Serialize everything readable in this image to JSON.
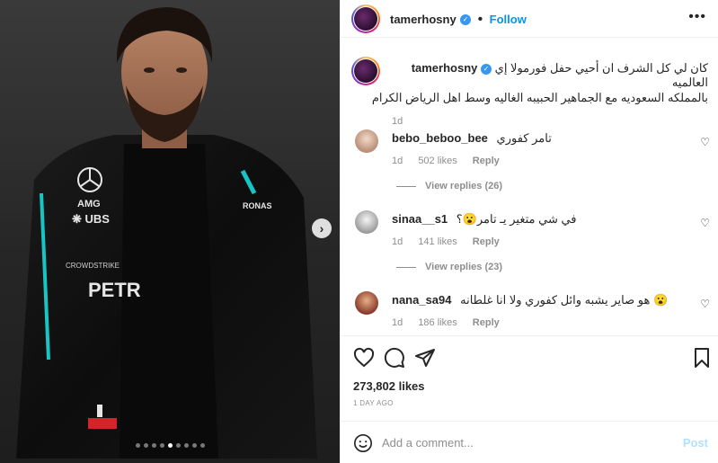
{
  "post": {
    "author": "tamerhosny",
    "follow_label": "Follow",
    "more_label": "•••",
    "caption_line1": "كان لي كل الشرف ان أحيي حفل فورمولا إي العالميه",
    "caption_line2": "بالمملكه السعوديه مع الجماهير الحبيبه الغاليه وسط اهل الرياض الكرام",
    "caption_age": "1d",
    "likes": "273,802 likes",
    "date": "1 DAY AGO",
    "carousel_next": "›",
    "carousel_dots": 9,
    "carousel_active": 5
  },
  "comments": [
    {
      "user": "bebo_beboo_bee",
      "text": "تامر كفوري",
      "age": "1d",
      "likes": "502 likes",
      "reply": "Reply",
      "view_replies": "View replies (26)"
    },
    {
      "user": "sinaa__s1",
      "text": "في شي متغير يـ تامر😮؟",
      "age": "1d",
      "likes": "141 likes",
      "reply": "Reply",
      "view_replies": "View replies (23)"
    },
    {
      "user": "nana_sa94",
      "text": "هو صاير يشبه وائل كفوري ولا انا غلطانه 😮",
      "age": "1d",
      "likes": "186 likes",
      "reply": "Reply",
      "view_replies": ""
    }
  ],
  "composer": {
    "placeholder": "Add a comment...",
    "post_label": "Post"
  },
  "colors": {
    "accent": "#0095f6",
    "muted": "#8e8e8e",
    "post_disabled": "#b2dffc"
  }
}
